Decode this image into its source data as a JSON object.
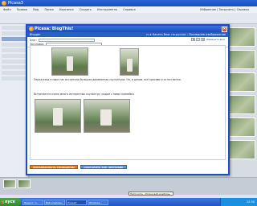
{
  "background_app": {
    "title": "Picasa3",
    "menu": [
      "Файл",
      "Правка",
      "Вид",
      "Папка",
      "Картинка",
      "Создать",
      "Инструменты",
      "Справка"
    ],
    "menu_right": "Избранное | Загрузить | Справка"
  },
  "dialog": {
    "title": "Picasa: BlogThis!",
    "header_left": "Blogger",
    "header_right": "ru ▾ Начать блог по-русски  :  Последнее изображение",
    "close_glyph": "×",
    "fields": {
      "blog_label": "Блог:",
      "title_label": "Заголовок:"
    },
    "toolbar": {
      "bold": "B",
      "italic": "I",
      "link": "≡",
      "layout": "Изменить фон"
    },
    "caption1": "Перед вход в парк нас встретила большая деревянная скульптура. Но, в целом, всё красиво и естественно.",
    "caption2": "Встречается очень много интересных скульптур, рядом с ними скамейки.",
    "buttons": {
      "publish": "ОПУБЛИКОВАТЬ СООБЩЕНИЕ",
      "draft": "СОХРАНИТЬ КАК ЧЕРНОВИК"
    }
  },
  "tooltip": "Загрузить - Picasa веб-альбомы",
  "taskbar": {
    "start": "пуск",
    "tasks": [
      "Яндекс: Ч...",
      "Веб-альбомы",
      "Picasa3",
      "Windows..."
    ],
    "clock": "12:30"
  }
}
